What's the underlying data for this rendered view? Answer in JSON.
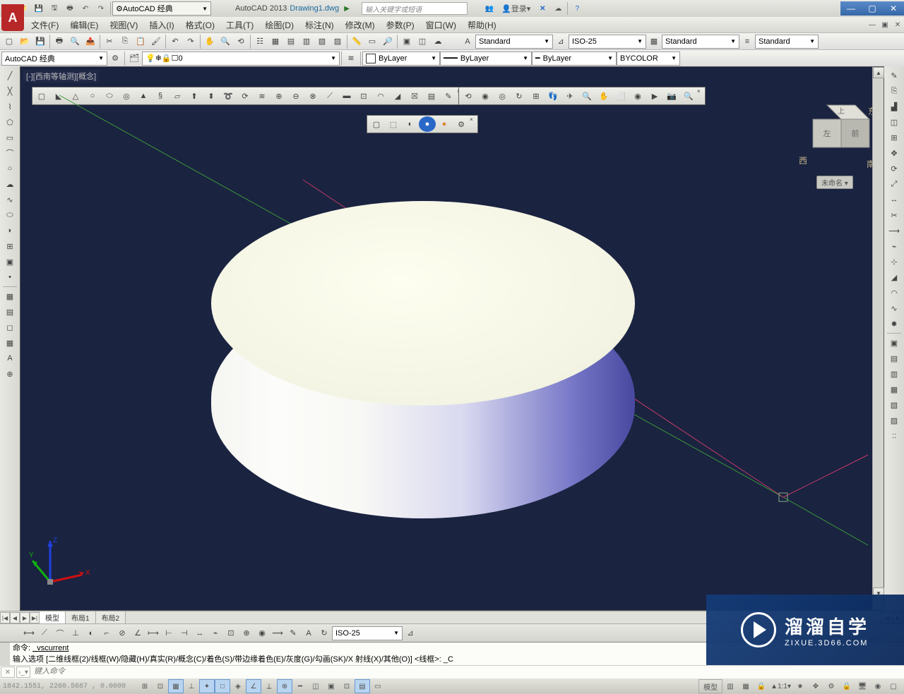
{
  "title": {
    "workspace_dd": "AutoCAD 经典",
    "app": "AutoCAD 2013",
    "doc": "Drawing1.dwg",
    "search_placeholder": "输入关键字或短语",
    "login": "登录"
  },
  "menu": {
    "file": "文件(F)",
    "edit": "编辑(E)",
    "view": "视图(V)",
    "insert": "插入(I)",
    "format": "格式(O)",
    "tools": "工具(T)",
    "draw": "绘图(D)",
    "dim": "标注(N)",
    "modify": "修改(M)",
    "param": "参数(P)",
    "window": "窗口(W)",
    "help": "帮助(H)"
  },
  "row2": {
    "workspace_dd": "AutoCAD 经典",
    "layer": "0"
  },
  "props": {
    "bylayer1": "ByLayer",
    "bylayer2": "ByLayer",
    "bylayer3": "ByLayer",
    "bycolor": "BYCOLOR"
  },
  "styles": {
    "text": "Standard",
    "dim": "ISO-25",
    "table": "Standard",
    "mls": "Standard"
  },
  "canvas": {
    "viewlabel": "[-][西南等轴测][概念]"
  },
  "viewcube": {
    "top_face": "上",
    "left_face": "左",
    "front_face": "前",
    "east": "东",
    "west": "西",
    "south": "南",
    "unnamed": "未命名 ▾"
  },
  "tabs": {
    "model": "模型",
    "layout1": "布局1",
    "layout2": "布局2"
  },
  "dimbar": {
    "dd": "ISO-25"
  },
  "cmd": {
    "line1_label": "命令:",
    "line1_value": "_vscurrent",
    "line2": "输入选项 [二维线框(2)/线框(W)/隐藏(H)/真实(R)/概念(C)/着色(S)/带边缘着色(E)/灰度(G)/勾画(SK)/X 射线(X)/其他(O)] <线框>: _C",
    "placeholder": "键入命令"
  },
  "status": {
    "coords": "1842.1551, 2260.5687 , 0.0000",
    "model": "模型",
    "scale": "1:1"
  },
  "axes": {
    "x": "X",
    "y": "Y",
    "z": "Z"
  },
  "watermark": {
    "cn": "溜溜自学",
    "en": "ZIXUE.3D66.COM"
  }
}
